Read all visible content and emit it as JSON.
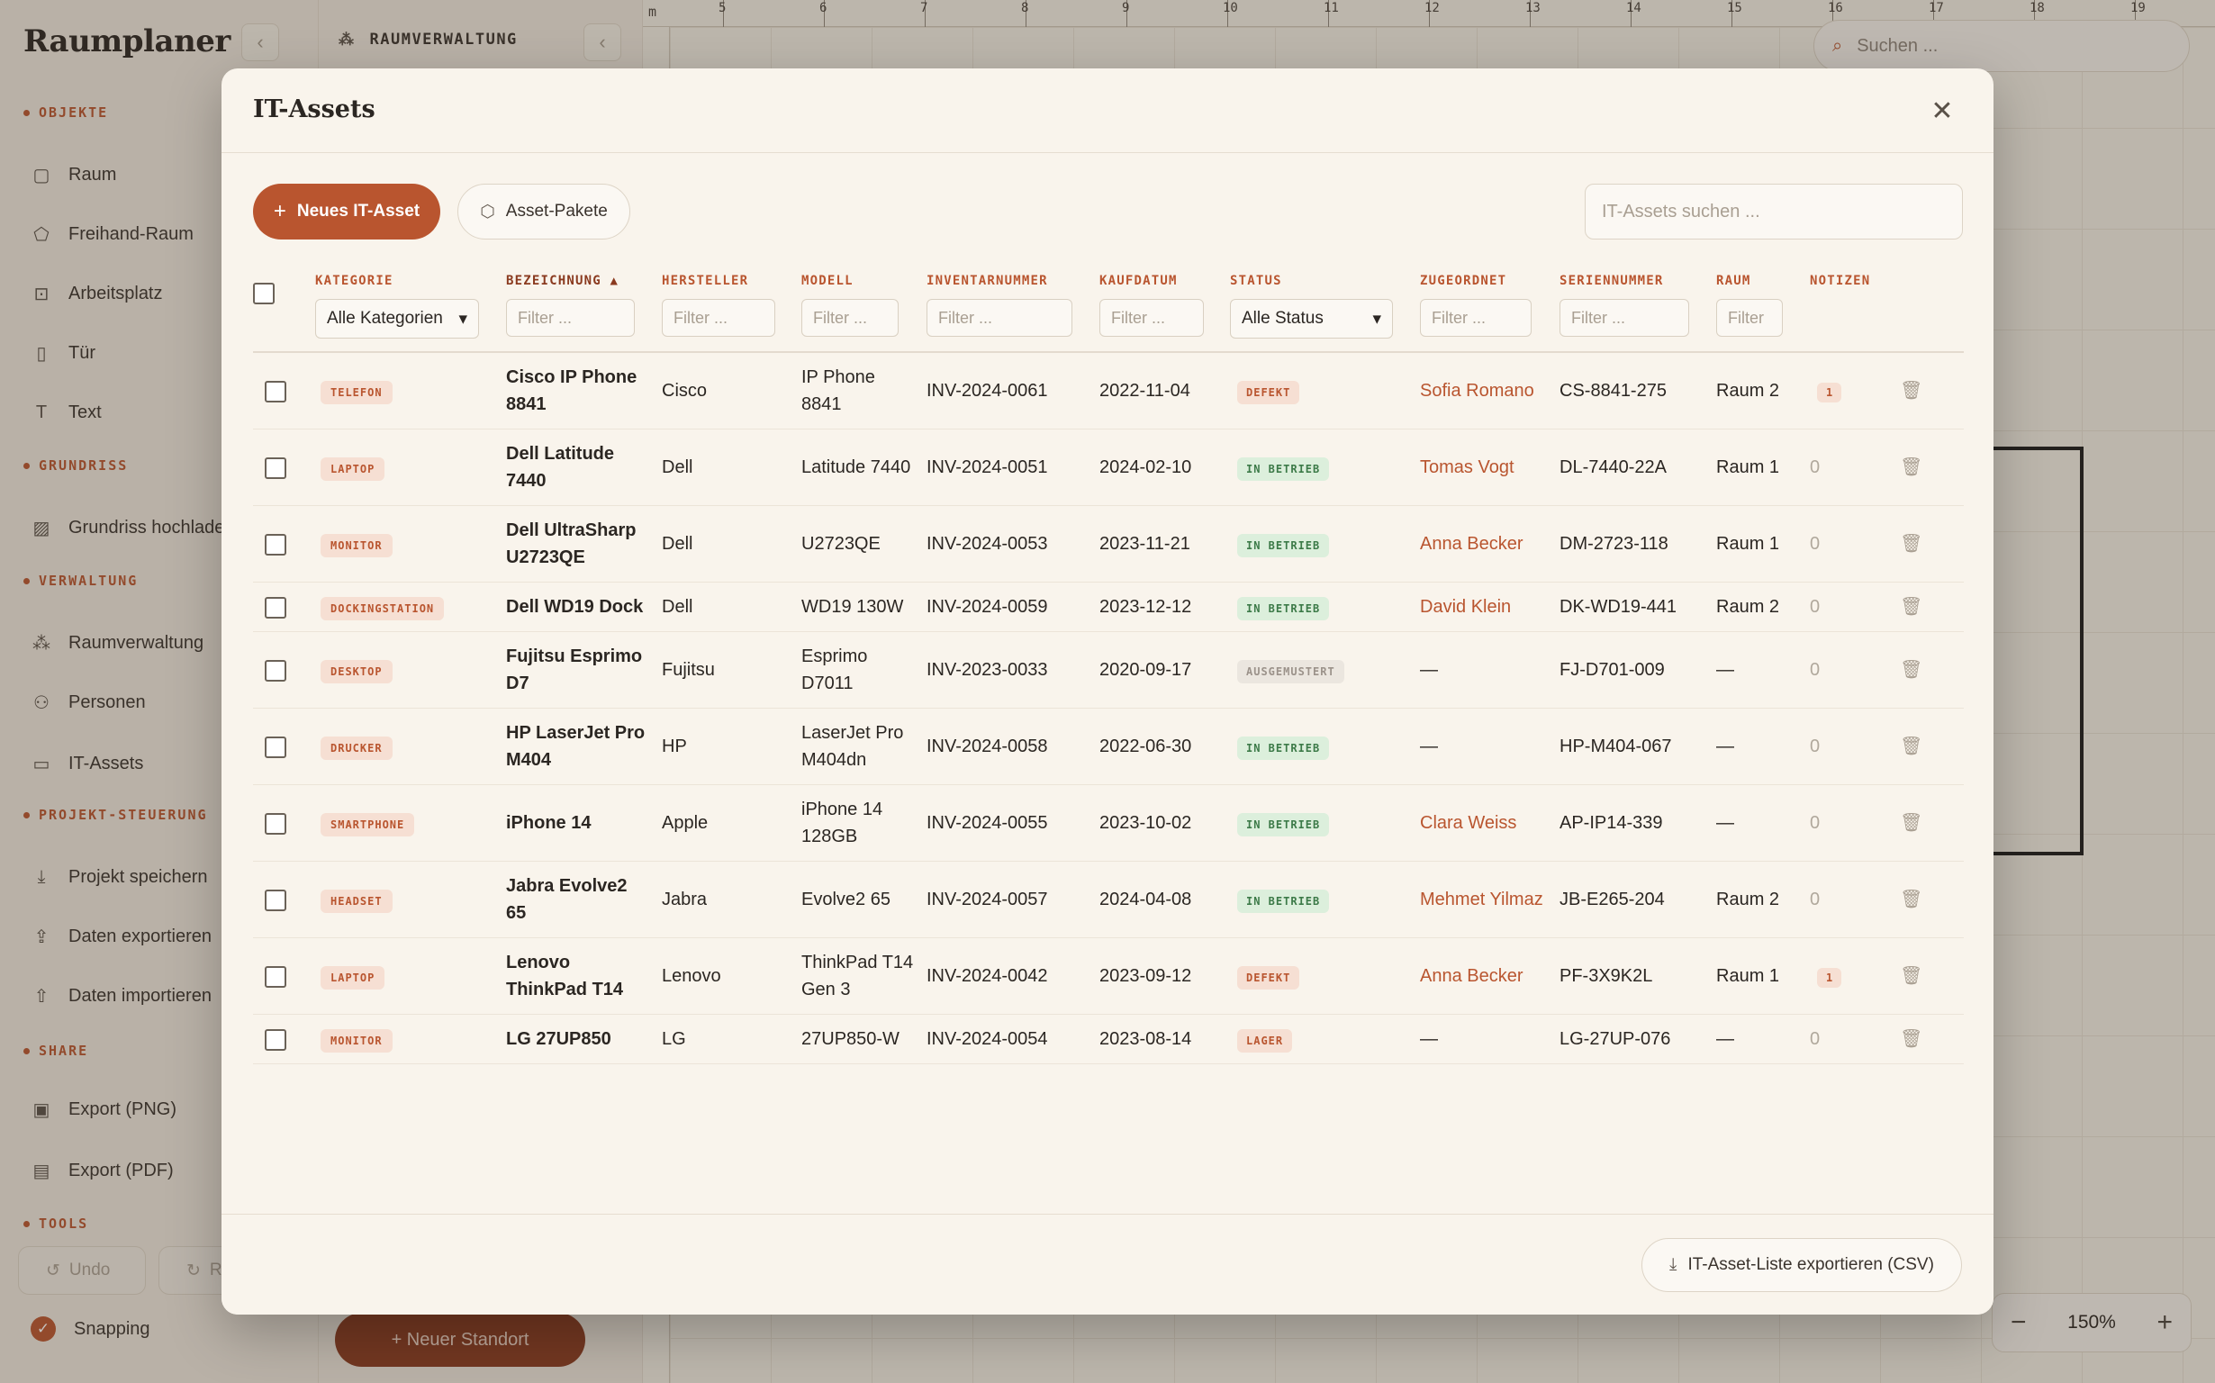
{
  "app": {
    "title": "Raumplaner",
    "collapse_icon": "‹"
  },
  "sidebar": {
    "sections": [
      {
        "label": "OBJEKTE",
        "items": [
          {
            "label": "Raum",
            "icon": "▢"
          },
          {
            "label": "Freihand-Raum",
            "icon": "⬠"
          },
          {
            "label": "Arbeitsplatz",
            "icon": "⊡"
          },
          {
            "label": "Tür",
            "icon": "▯"
          },
          {
            "label": "Text",
            "icon": "T"
          }
        ]
      },
      {
        "label": "GRUNDRISS",
        "items": [
          {
            "label": "Grundriss hochladen",
            "icon": "▨"
          }
        ]
      },
      {
        "label": "VERWALTUNG",
        "items": [
          {
            "label": "Raumverwaltung",
            "icon": "⁂"
          },
          {
            "label": "Personen",
            "icon": "⚇"
          },
          {
            "label": "IT-Assets",
            "icon": "▭"
          }
        ]
      },
      {
        "label": "PROJEKT-STEUERUNG",
        "items": [
          {
            "label": "Projekt speichern",
            "icon": "⤓"
          },
          {
            "label": "Daten exportieren",
            "icon": "⇪"
          },
          {
            "label": "Daten importieren",
            "icon": "⇧"
          }
        ]
      },
      {
        "label": "SHARE",
        "items": [
          {
            "label": "Export (PNG)",
            "icon": "▣"
          },
          {
            "label": "Export (PDF)",
            "icon": "▤"
          }
        ]
      },
      {
        "label": "TOOLS",
        "items": []
      }
    ],
    "undo_label": "Undo",
    "redo_label": "R",
    "snapping_label": "Snapping"
  },
  "midpanel": {
    "breadcrumb": "RAUMVERWALTUNG",
    "new_site_label": "+ Neuer Standort"
  },
  "canvas": {
    "ruler_unit": "m",
    "ruler_ticks": [
      "5",
      "6",
      "7",
      "8",
      "9",
      "10",
      "11",
      "12",
      "13",
      "14",
      "15",
      "16",
      "17",
      "18",
      "19"
    ],
    "search_placeholder": "Suchen ...",
    "zoom_level": "150%",
    "zoom_out": "−",
    "zoom_in": "+"
  },
  "modal": {
    "title": "IT-Assets",
    "close_icon": "✕",
    "new_asset_label": "Neues IT-Asset",
    "packages_label": "Asset-Pakete",
    "search_placeholder": "IT-Assets suchen ...",
    "export_label": "IT-Asset-Liste exportieren (CSV)",
    "columns": {
      "kategorie": "KATEGORIE",
      "bezeichnung": "BEZEICHNUNG ▲",
      "hersteller": "HERSTELLER",
      "modell": "MODELL",
      "inventarnummer": "INVENTARNUMMER",
      "kaufdatum": "KAUFDATUM",
      "status": "STATUS",
      "zugeordnet": "ZUGEORDNET",
      "seriennummer": "SERIENNUMMER",
      "raum": "RAUM",
      "notizen": "NOTIZEN"
    },
    "filters": {
      "kategorie_selected": "Alle Kategorien",
      "status_selected": "Alle Status",
      "text_placeholder": "Filter ...",
      "raum_placeholder": "Filter"
    },
    "rows": [
      {
        "category": "TELEFON",
        "name": "Cisco IP Phone 8841",
        "maker": "Cisco",
        "model": "IP Phone 8841",
        "inv": "INV-2024-0061",
        "date": "2022-11-04",
        "status": "DEFEKT",
        "assignee": "Sofia Romano",
        "serial": "CS-8841-275",
        "room": "Raum 2",
        "notes": "1"
      },
      {
        "category": "LAPTOP",
        "name": "Dell Latitude 7440",
        "maker": "Dell",
        "model": "Latitude 7440",
        "inv": "INV-2024-0051",
        "date": "2024-02-10",
        "status": "IN BETRIEB",
        "assignee": "Tomas Vogt",
        "serial": "DL-7440-22A",
        "room": "Raum 1",
        "notes": "0"
      },
      {
        "category": "MONITOR",
        "name": "Dell UltraSharp U2723QE",
        "maker": "Dell",
        "model": "U2723QE",
        "inv": "INV-2024-0053",
        "date": "2023-11-21",
        "status": "IN BETRIEB",
        "assignee": "Anna Becker",
        "serial": "DM-2723-118",
        "room": "Raum 1",
        "notes": "0"
      },
      {
        "category": "DOCKINGSTATION",
        "name": "Dell WD19 Dock",
        "maker": "Dell",
        "model": "WD19 130W",
        "inv": "INV-2024-0059",
        "date": "2023-12-12",
        "status": "IN BETRIEB",
        "assignee": "David Klein",
        "serial": "DK-WD19-441",
        "room": "Raum 2",
        "notes": "0"
      },
      {
        "category": "DESKTOP",
        "name": "Fujitsu Esprimo D7",
        "maker": "Fujitsu",
        "model": "Esprimo D7011",
        "inv": "INV-2023-0033",
        "date": "2020-09-17",
        "status": "AUSGEMUSTERT",
        "assignee": "—",
        "serial": "FJ-D701-009",
        "room": "—",
        "notes": "0"
      },
      {
        "category": "DRUCKER",
        "name": "HP LaserJet Pro M404",
        "maker": "HP",
        "model": "LaserJet Pro M404dn",
        "inv": "INV-2024-0058",
        "date": "2022-06-30",
        "status": "IN BETRIEB",
        "assignee": "—",
        "serial": "HP-M404-067",
        "room": "—",
        "notes": "0"
      },
      {
        "category": "SMARTPHONE",
        "name": "iPhone 14",
        "maker": "Apple",
        "model": "iPhone 14 128GB",
        "inv": "INV-2024-0055",
        "date": "2023-10-02",
        "status": "IN BETRIEB",
        "assignee": "Clara Weiss",
        "serial": "AP-IP14-339",
        "room": "—",
        "notes": "0"
      },
      {
        "category": "HEADSET",
        "name": "Jabra Evolve2 65",
        "maker": "Jabra",
        "model": "Evolve2 65",
        "inv": "INV-2024-0057",
        "date": "2024-04-08",
        "status": "IN BETRIEB",
        "assignee": "Mehmet Yilmaz",
        "serial": "JB-E265-204",
        "room": "Raum 2",
        "notes": "0"
      },
      {
        "category": "LAPTOP",
        "name": "Lenovo ThinkPad T14",
        "maker": "Lenovo",
        "model": "ThinkPad T14 Gen 3",
        "inv": "INV-2024-0042",
        "date": "2023-09-12",
        "status": "DEFEKT",
        "assignee": "Anna Becker",
        "serial": "PF-3X9K2L",
        "room": "Raum 1",
        "notes": "1"
      },
      {
        "category": "MONITOR",
        "name": "LG 27UP850",
        "maker": "LG",
        "model": "27UP850-W",
        "inv": "INV-2024-0054",
        "date": "2023-08-14",
        "status": "LAGER",
        "assignee": "—",
        "serial": "LG-27UP-076",
        "room": "—",
        "notes": "0"
      }
    ],
    "colors": {
      "accent": "#b9552f",
      "status_ok": "#3c7a48",
      "status_retired": "#9b928a"
    }
  }
}
